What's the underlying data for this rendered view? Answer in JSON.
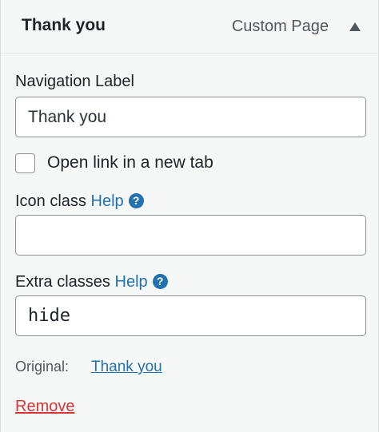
{
  "header": {
    "title": "Thank you",
    "item_type": "Custom Page",
    "toggle_icon": "triangle-up-icon"
  },
  "navigation_label": {
    "label": "Navigation Label",
    "value": "Thank you"
  },
  "new_tab": {
    "label": "Open link in a new tab",
    "checked": false
  },
  "icon_class": {
    "label": "Icon class",
    "help_label": "Help",
    "help_icon": "question-circle-icon",
    "value": ""
  },
  "extra_classes": {
    "label": "Extra classes",
    "help_label": "Help",
    "help_icon": "question-circle-icon",
    "value": "hide"
  },
  "original": {
    "label": "Original:",
    "link": "Thank you"
  },
  "remove_label": "Remove",
  "colors": {
    "link": "#2271b1",
    "danger": "#d63638",
    "panel_bg": "#f6f7f7"
  }
}
